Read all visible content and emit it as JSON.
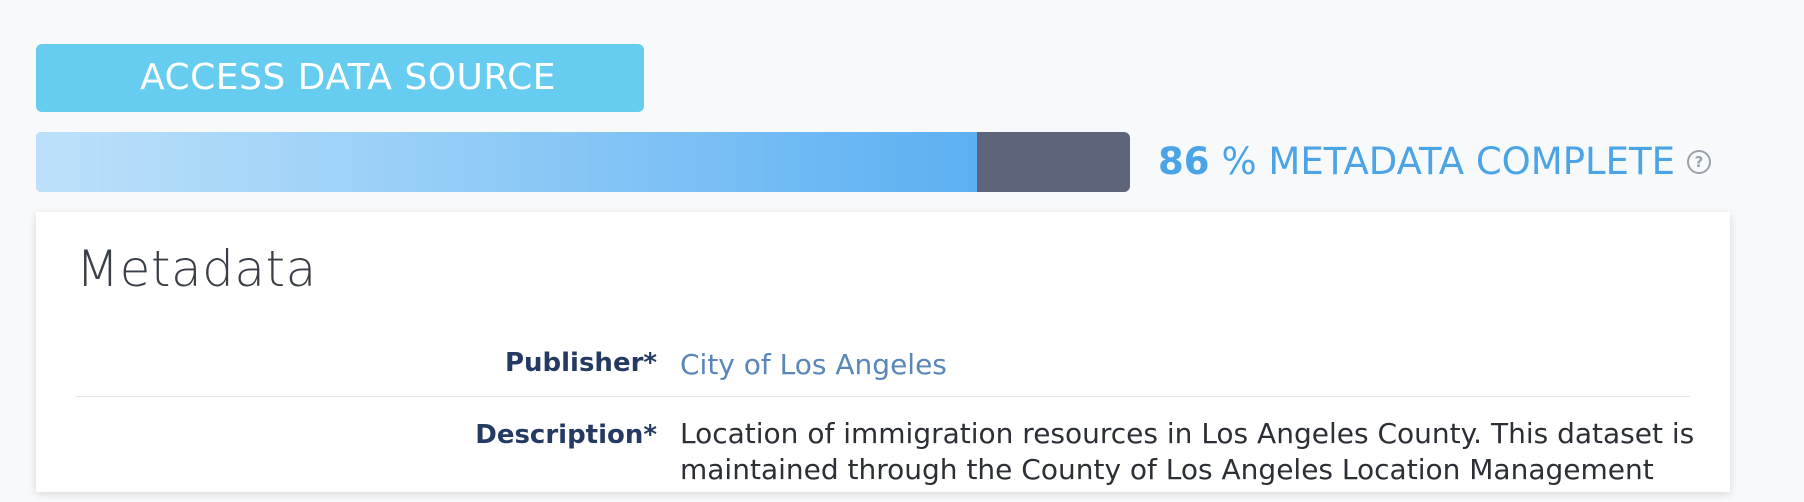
{
  "access_button": {
    "label": "ACCESS DATA SOURCE"
  },
  "metadata_progress": {
    "percent": 86,
    "percent_label": "86",
    "suffix": "% METADATA COMPLETE",
    "fill_color_start": "#bde1fa",
    "fill_color_end": "#5cb0f2",
    "track_color": "#5e6479",
    "help_icon": "question-circle-icon"
  },
  "metadata_card": {
    "title": "Metadata",
    "rows": [
      {
        "label": "Publisher*",
        "value": "City of Los Angeles",
        "link": true
      },
      {
        "label": "Description*",
        "value": "Location of immigration resources in Los Angeles County. This dataset is",
        "value_line2": "maintained through the County of Los Angeles Location Management",
        "link": false
      }
    ]
  },
  "colors": {
    "accent": "#66cdf1",
    "progress_text": "#4ba4e6",
    "label": "#253a63",
    "link": "#5a86b8"
  }
}
